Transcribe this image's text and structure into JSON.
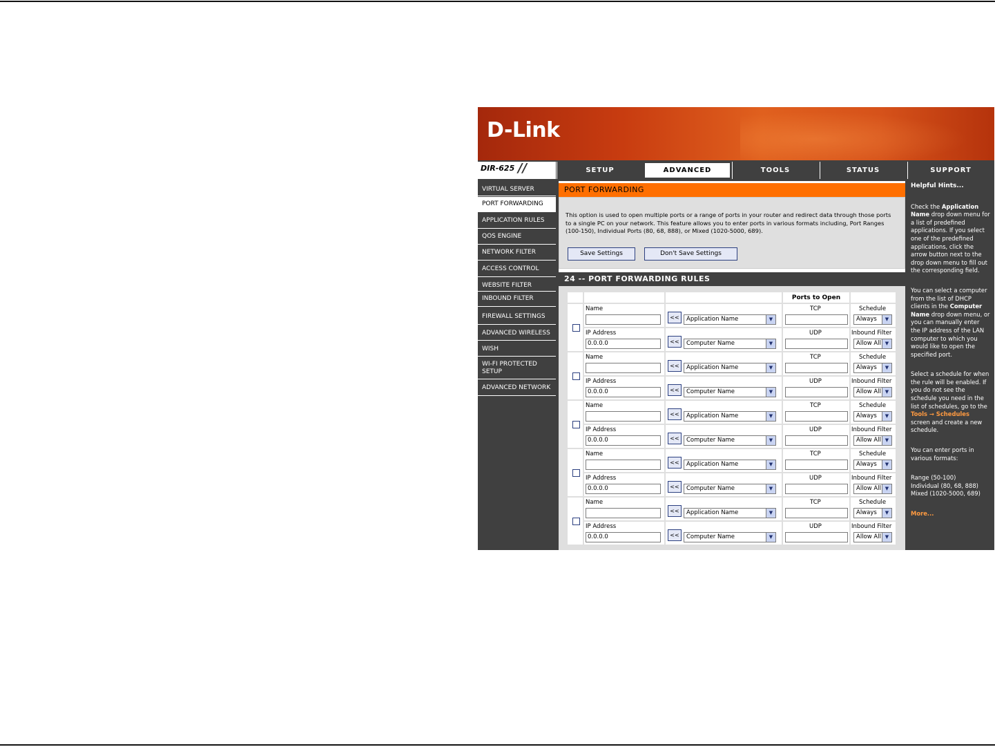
{
  "banner": {
    "logo": "D-Link"
  },
  "model": {
    "label": "DIR-625",
    "slashes": "//"
  },
  "tabs": [
    {
      "label": "SETUP",
      "active": false
    },
    {
      "label": "ADVANCED",
      "active": true
    },
    {
      "label": "TOOLS",
      "active": false
    },
    {
      "label": "STATUS",
      "active": false
    },
    {
      "label": "SUPPORT",
      "active": false
    }
  ],
  "sidebar": {
    "items": [
      {
        "label": "VIRTUAL SERVER"
      },
      {
        "label": "PORT FORWARDING",
        "active": true
      },
      {
        "label": "APPLICATION RULES"
      },
      {
        "label": "QOS ENGINE"
      },
      {
        "label": "NETWORK FILTER"
      },
      {
        "label": "ACCESS CONTROL"
      },
      {
        "label": "WEBSITE FILTER"
      },
      {
        "label": "INBOUND FILTER"
      },
      {
        "label": "FIREWALL SETTINGS"
      },
      {
        "label": "ADVANCED WIRELESS"
      },
      {
        "label": "WISH"
      },
      {
        "label": "WI-FI PROTECTED SETUP"
      },
      {
        "label": "ADVANCED NETWORK"
      }
    ]
  },
  "port_forwarding": {
    "title": "PORT FORWARDING",
    "description": "This option is used to open multiple ports or a range of ports in your router and redirect data through those ports to a single PC on your network. This feature allows you to enter ports in various formats including, Port Ranges (100-150), Individual Ports (80, 68, 888), or Mixed (1020-5000, 689).",
    "save_label": "Save Settings",
    "dont_save_label": "Don't Save Settings"
  },
  "rules": {
    "title": "24 -- PORT FORWARDING RULES",
    "ports_header": "Ports to Open",
    "labels": {
      "name": "Name",
      "ip": "IP Address",
      "tcp": "TCP",
      "udp": "UDP",
      "schedule": "Schedule",
      "inbound": "Inbound Filter",
      "arrow": "<<"
    },
    "defaults": {
      "ip_value": "0.0.0.0",
      "app_select": "Application Name",
      "computer_select": "Computer Name",
      "schedule_select": "Always",
      "inbound_select": "Allow All"
    },
    "count_visible": 5
  },
  "hints": {
    "title": "Helpful Hints...",
    "p1_a": "Check the ",
    "p1_b": "Application Name",
    "p1_c": " drop down menu for a list of predefined applications. If you select one of the predefined applications, click the arrow button next to the drop down menu to fill out the corresponding field.",
    "p2_a": "You can select a computer from the list of DHCP clients in the ",
    "p2_b": "Computer Name",
    "p2_c": " drop down menu, or you can manually enter the IP address of the LAN computer to which you would like to open the specified port.",
    "p3_a": "Select a schedule for when the rule will be enabled. If you do not see the schedule you need in the list of schedules, go to the ",
    "p3_link": "Tools → Schedules",
    "p3_c": " screen and create a new schedule.",
    "p4": "You can enter ports in various formats:",
    "formats": [
      "Range (50-100)",
      "Individual (80, 68, 888)",
      "Mixed (1020-5000, 689)"
    ],
    "more": "More..."
  },
  "colors": {
    "accent": "#ff6f00",
    "dark": "#404040",
    "panel": "#dfdfdf",
    "link": "#ff9a40"
  }
}
